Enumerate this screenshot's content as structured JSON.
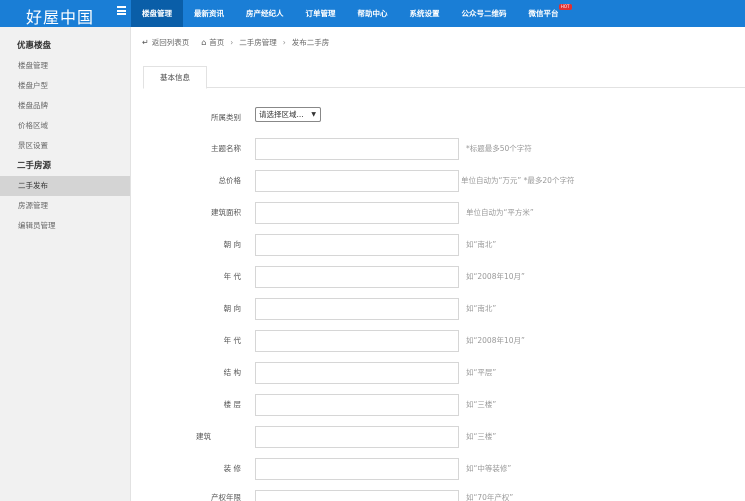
{
  "brand": {
    "title": "好屋中国"
  },
  "nav": [
    {
      "label": "楼盘管理",
      "active": true
    },
    {
      "label": "最新资讯",
      "active": false
    },
    {
      "label": "房产经纪人",
      "active": false
    },
    {
      "label": "订单管理",
      "active": false
    },
    {
      "label": "帮助中心",
      "active": false
    },
    {
      "label": "系统设置",
      "active": false
    },
    {
      "label": "公众号二维码",
      "active": false
    },
    {
      "label": "微信平台",
      "active": false,
      "badge": "HOT"
    }
  ],
  "sidebar": {
    "groups": [
      {
        "title": "优惠楼盘",
        "items": [
          {
            "label": "楼盘管理"
          },
          {
            "label": "楼盘户型"
          },
          {
            "label": "楼盘品牌"
          },
          {
            "label": "价格区域"
          },
          {
            "label": "景区设置"
          }
        ]
      },
      {
        "title": "二手房源",
        "items": [
          {
            "label": "二手发布",
            "active": true
          },
          {
            "label": "房源管理"
          },
          {
            "label": "编辑员管理"
          }
        ]
      }
    ]
  },
  "breadcrumb": {
    "back": "返回列表页",
    "home": "首页",
    "section": "二手房管理",
    "current": "发布二手房"
  },
  "tab": {
    "label": "基本信息"
  },
  "form": {
    "category": {
      "label": "所属类别",
      "selected": "请选择区域..."
    },
    "fields": [
      {
        "label": "主题名称",
        "hint": "*标题最多50个字符"
      },
      {
        "label": "总价格",
        "hint": "单位自动为“万元”     *最多20个字符"
      },
      {
        "label": "建筑面积",
        "hint": "单位自动为“平方米”"
      },
      {
        "label": "朝 向",
        "hint": "如“南北”"
      },
      {
        "label": "年 代",
        "hint": "如“2008年10月”"
      },
      {
        "label": "朝 向",
        "hint": "如“南北”"
      },
      {
        "label": "年 代",
        "hint": "如“2008年10月”"
      },
      {
        "label": "结 构",
        "hint": "如“平层”"
      },
      {
        "label": "楼 层",
        "hint": "如“三楼”"
      },
      {
        "label": "建筑",
        "hint": "如“三楼”"
      },
      {
        "label": "装 修",
        "hint": "如“中等装修”"
      },
      {
        "label": "产权年限",
        "hint": "如“70年产权”"
      }
    ]
  }
}
